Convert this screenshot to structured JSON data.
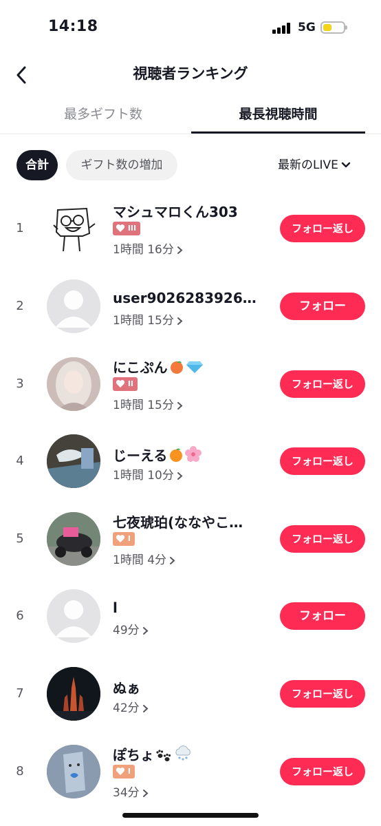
{
  "status": {
    "time": "14:18",
    "network": "5G"
  },
  "header": {
    "title": "視聴者ランキング"
  },
  "tabs": [
    {
      "label": "最多ギフト数"
    },
    {
      "label": "最長視聴時間"
    }
  ],
  "filters": {
    "total": "合計",
    "gift_increase": "ギフト数の増加",
    "live_select": "最新のLIVE"
  },
  "viewers": [
    {
      "rank": "1",
      "name": "マシュマロくん303",
      "badge": "III",
      "duration": "1時間 16分",
      "follow": "フォロー返し"
    },
    {
      "rank": "2",
      "name": "user90262839267…",
      "duration": "1時間 15分",
      "follow": "フォロー"
    },
    {
      "rank": "3",
      "name": "にこぷん",
      "badge": "II",
      "duration": "1時間 15分",
      "follow": "フォロー返し"
    },
    {
      "rank": "4",
      "name": "じーえる",
      "duration": "1時間 10分",
      "follow": "フォロー返し"
    },
    {
      "rank": "5",
      "name": "七夜琥珀(ななやこ…",
      "badge": "I",
      "duration": "1時間 4分",
      "follow": "フォロー返し"
    },
    {
      "rank": "6",
      "name": "l",
      "duration": "49分",
      "follow": "フォロー"
    },
    {
      "rank": "7",
      "name": "ぬぁ",
      "duration": "42分",
      "follow": "フォロー返し"
    },
    {
      "rank": "8",
      "name": "ぽちょ",
      "badge": "I",
      "duration": "34分",
      "follow": "フォロー返し"
    }
  ],
  "colors": {
    "accent": "#fe2c55",
    "badge_level3": "#e0727c",
    "badge_level1": "#f0a07a"
  }
}
